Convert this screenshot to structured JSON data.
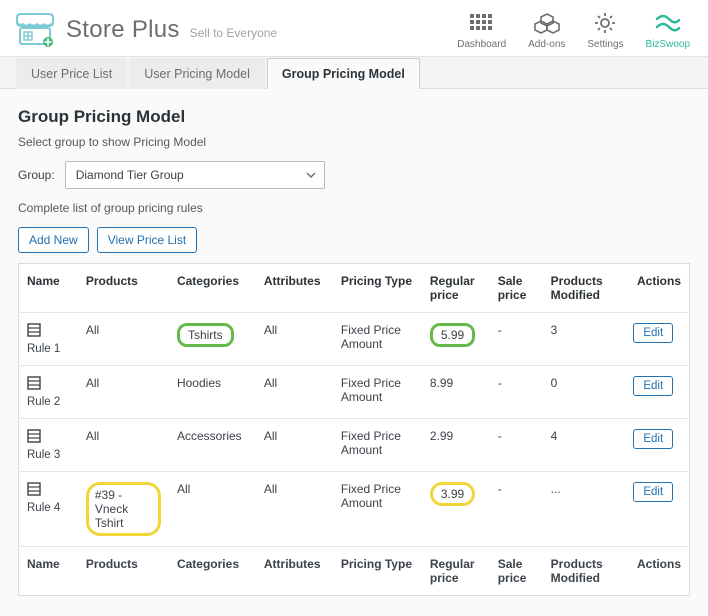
{
  "header": {
    "brand_name": "Store Plus",
    "tagline": "Sell to Everyone",
    "nav": {
      "dashboard": "Dashboard",
      "addons": "Add-ons",
      "settings": "Settings",
      "bizswoop": "BizSwoop"
    }
  },
  "tabs": {
    "user_price_list": "User Price List",
    "user_pricing_model": "User Pricing Model",
    "group_pricing_model": "Group Pricing Model"
  },
  "section": {
    "heading": "Group Pricing Model",
    "help1": "Select group to show Pricing Model",
    "group_label": "Group:",
    "group_selected": "Diamond Tier Group",
    "help2": "Complete list of group pricing rules",
    "add_new": "Add New",
    "view_price_list": "View Price List"
  },
  "columns": {
    "name": "Name",
    "products": "Products",
    "categories": "Categories",
    "attributes": "Attributes",
    "pricing_type": "Pricing Type",
    "regular_price": "Regular price",
    "sale_price": "Sale price",
    "products_modified": "Products Modified",
    "actions": "Actions"
  },
  "rows": [
    {
      "name": "Rule 1",
      "products": "All",
      "categories": "Tshirts",
      "attributes": "All",
      "pricing_type": "Fixed Price Amount",
      "regular": "5.99",
      "sale": "-",
      "modified": "3",
      "edit": "Edit",
      "highlight_cat": "green",
      "highlight_reg": "green"
    },
    {
      "name": "Rule 2",
      "products": "All",
      "categories": "Hoodies",
      "attributes": "All",
      "pricing_type": "Fixed Price Amount",
      "regular": "8.99",
      "sale": "-",
      "modified": "0",
      "edit": "Edit"
    },
    {
      "name": "Rule 3",
      "products": "All",
      "categories": "Accessories",
      "attributes": "All",
      "pricing_type": "Fixed Price Amount",
      "regular": "2.99",
      "sale": "-",
      "modified": "4",
      "edit": "Edit"
    },
    {
      "name": "Rule 4",
      "products": "#39 - Vneck Tshirt",
      "categories": "All",
      "attributes": "All",
      "pricing_type": "Fixed Price Amount",
      "regular": "3.99",
      "sale": "-",
      "modified": "...",
      "edit": "Edit",
      "highlight_prod": "yellow",
      "highlight_reg": "yellow"
    }
  ]
}
